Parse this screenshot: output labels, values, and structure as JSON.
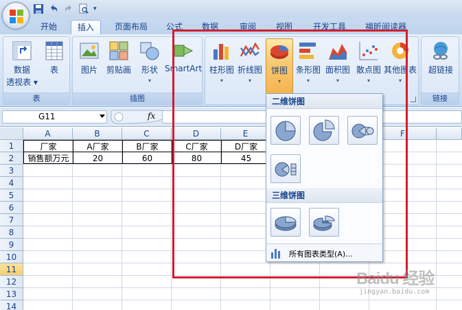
{
  "tabs": [
    "开始",
    "插入",
    "页面布局",
    "公式",
    "数据",
    "审阅",
    "视图",
    "开发工具",
    "福昕阅读器"
  ],
  "active_tab": "插入",
  "ribbon": {
    "table_group": {
      "label": "表",
      "pivot_line1": "数据",
      "pivot_line2": "透视表",
      "table": "表"
    },
    "illustrations_group": {
      "label": "插图",
      "picture": "图片",
      "clipart": "剪贴画",
      "shapes": "形状",
      "smartart": "SmartArt"
    },
    "charts_group": {
      "column": "柱形图",
      "line": "折线图",
      "pie": "饼图",
      "bar": "条形图",
      "area": "面积图",
      "scatter": "散点图",
      "other": "其他图表"
    },
    "links_group": {
      "label": "链接",
      "hyperlink": "超链接"
    }
  },
  "formula_bar": {
    "name_box": "G11",
    "fx": "fx",
    "formula": ""
  },
  "columns": [
    "A",
    "B",
    "C",
    "D",
    "E",
    "F"
  ],
  "rows": [
    "1",
    "2",
    "3",
    "4",
    "5",
    "6",
    "7",
    "8",
    "9",
    "10",
    "11",
    "12",
    "13",
    "14"
  ],
  "cells": {
    "A1": "厂家",
    "B1": "A厂家",
    "C1": "B厂家",
    "D1": "C厂家",
    "E1": "D厂家",
    "A2": "销售额万元",
    "B2": "20",
    "C2": "60",
    "D2": "80",
    "E2": "45"
  },
  "dropdown": {
    "section_2d": "二维饼图",
    "section_3d": "三维饼图",
    "all_chart_types": "所有图表类型(A)..."
  },
  "watermark": {
    "main": "Baidu 经验",
    "sub": "jingyan.baidu.com"
  },
  "colors": {
    "highlight": "#d41c2e",
    "ribbon_text": "#15428b",
    "pressed": "#f8c871"
  }
}
